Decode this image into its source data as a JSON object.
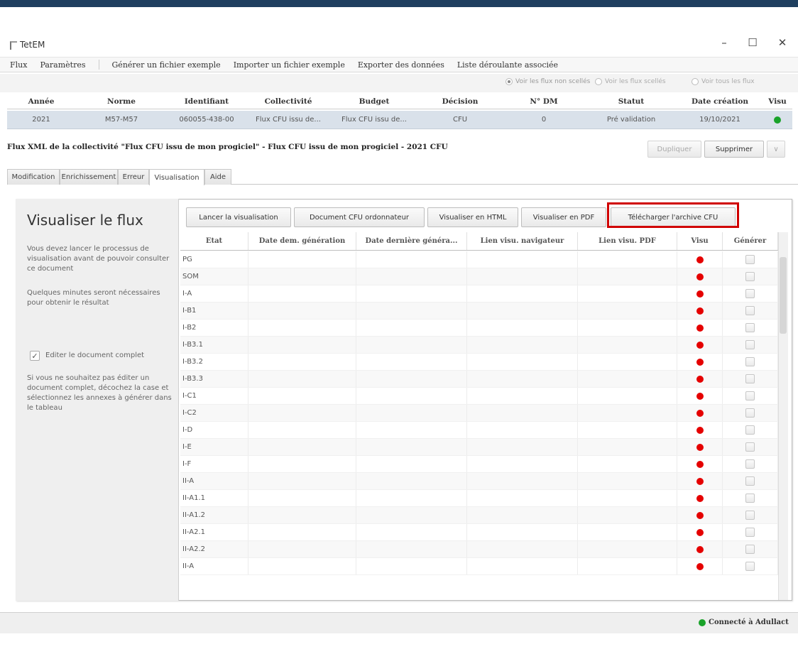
{
  "app": {
    "title": "TetEM"
  },
  "window": {
    "minimize": "–",
    "maximize": "☐",
    "close": "✕"
  },
  "menu": {
    "flux": "Flux",
    "parametres": "Paramètres",
    "generer": "Générer un fichier exemple",
    "importer": "Importer un fichier exemple",
    "exporter": "Exporter des données",
    "liste": "Liste déroulante associée"
  },
  "filters": {
    "non_scelles": "Voir les flux non scellés",
    "scelles": "Voir les flux scellés",
    "tous": "Voir tous les flux",
    "selected": "non_scelles"
  },
  "flux_table": {
    "headers": [
      "Année",
      "Norme",
      "Identifiant",
      "Collectivité",
      "Budget",
      "Décision",
      "N° DM",
      "Statut",
      "Date création",
      "Visu"
    ],
    "row": [
      "2021",
      "M57-M57",
      "060055-438-00",
      "Flux CFU issu de...",
      "Flux CFU issu de...",
      "CFU",
      "0",
      "Pré validation",
      "19/10/2021",
      ""
    ],
    "visu_color": "#1aa32a"
  },
  "flux_info": "Flux XML de la collectivité \"Flux CFU issu de mon progiciel\" - Flux CFU issu de mon progiciel - 2021 CFU",
  "actions": {
    "dupliquer": "Dupliquer",
    "supprimer": "Supprimer",
    "more": "∨"
  },
  "tabs": [
    "Modification",
    "Enrichissement",
    "Erreur",
    "Visualisation",
    "Aide"
  ],
  "active_tab": "Visualisation",
  "sidebar": {
    "title": "Visualiser le flux",
    "text1": "Vous devez lancer le processus de visualisation avant de pouvoir consulter ce document",
    "text2": "Quelques minutes seront nécessaires pour obtenir le résultat",
    "checkbox_label": "Editer le document complet",
    "checkbox_checked": true,
    "checkmark": "✓",
    "text3": "Si vous ne souhaitez pas éditer un document complet, décochez la case et sélectionnez les annexes à générer dans le tableau"
  },
  "viz_buttons": {
    "lancer": "Lancer la visualisation",
    "document": "Document CFU ordonnateur",
    "html": "Visualiser en HTML",
    "pdf": "Visualiser en PDF",
    "archive": "Télécharger l'archive CFU",
    "highlight_color": "#d00000"
  },
  "annex_table": {
    "headers": [
      "Etat",
      "Date dem. génération",
      "Date dernière généra...",
      "Lien visu. navigateur",
      "Lien visu. PDF",
      "Visu",
      "Générer"
    ],
    "rows": [
      "PG",
      "SOM",
      "I-A",
      "I-B1",
      "I-B2",
      "I-B3.1",
      "I-B3.2",
      "I-B3.3",
      "I-C1",
      "I-C2",
      "I-D",
      "I-E",
      "I-F",
      "II-A",
      "II-A1.1",
      "II-A1.2",
      "II-A2.1",
      "II-A2.2",
      "II-A"
    ],
    "visu_color": "#e50000"
  },
  "status": {
    "text": "Connecté à Adullact",
    "color": "#1aa32a"
  }
}
